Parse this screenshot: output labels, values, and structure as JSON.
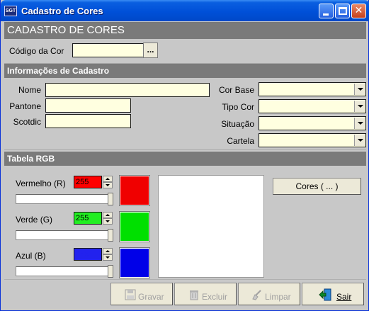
{
  "window": {
    "title": "Cadastro de Cores",
    "icon": "app-logo-icon",
    "icon_text": "SGT"
  },
  "header": {
    "title": "CADASTRO DE CORES"
  },
  "codigo": {
    "label": "Código da Cor",
    "value": "",
    "lookup_label": "..."
  },
  "info_section": {
    "title": "Informações de Cadastro",
    "nome": {
      "label": "Nome",
      "value": ""
    },
    "pantone": {
      "label": "Pantone",
      "value": ""
    },
    "scotdic": {
      "label": "Scotdic",
      "value": ""
    },
    "cor_base": {
      "label": "Cor Base",
      "value": ""
    },
    "tipo_cor": {
      "label": "Tipo Cor",
      "value": ""
    },
    "situacao": {
      "label": "Situação",
      "value": ""
    },
    "cartela": {
      "label": "Cartela",
      "value": ""
    }
  },
  "rgb_section": {
    "title": "Tabela RGB",
    "red": {
      "label": "Vermelho (R)",
      "value": "255",
      "color": "#ff0000",
      "swatch": "#f00000"
    },
    "green": {
      "label": "Verde (G)",
      "value": "255",
      "color": "#22ee22",
      "swatch": "#00e000"
    },
    "blue": {
      "label": "Azul (B)",
      "value": "255",
      "color": "#2222ee",
      "swatch": "#0000e8"
    },
    "cores_button": "Cores ( ... )"
  },
  "footer": {
    "gravar": "Gravar",
    "excluir": "Excluir",
    "limpar": "Limpar",
    "sair": "Sair"
  },
  "colors": {
    "titlebar": "#0050d8",
    "section": "#7a7a7a",
    "input_bg": "#ffffe0",
    "window_bg": "#c8c8c8"
  }
}
